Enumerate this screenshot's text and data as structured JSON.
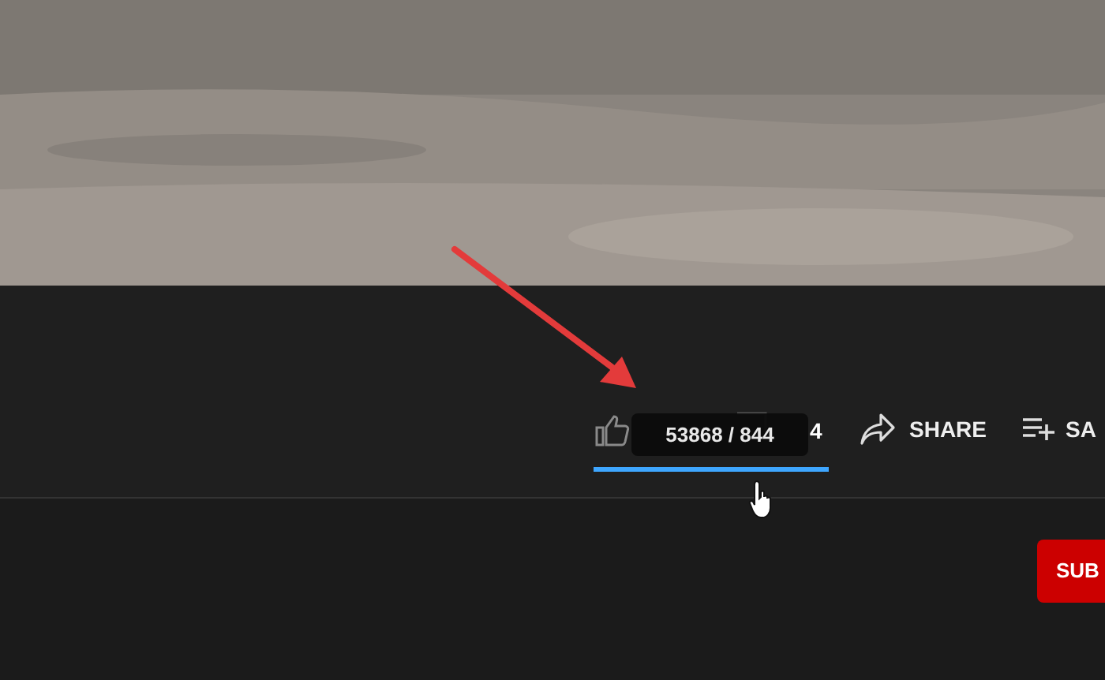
{
  "rating": {
    "dislike_count": "4",
    "tooltip": "53868 / 844",
    "level": 1
  },
  "actions": [
    {
      "kind": "share",
      "label": "SHARE"
    },
    {
      "kind": "save",
      "label": "SA"
    }
  ],
  "subscribe_button": {
    "label": "SUB"
  }
}
